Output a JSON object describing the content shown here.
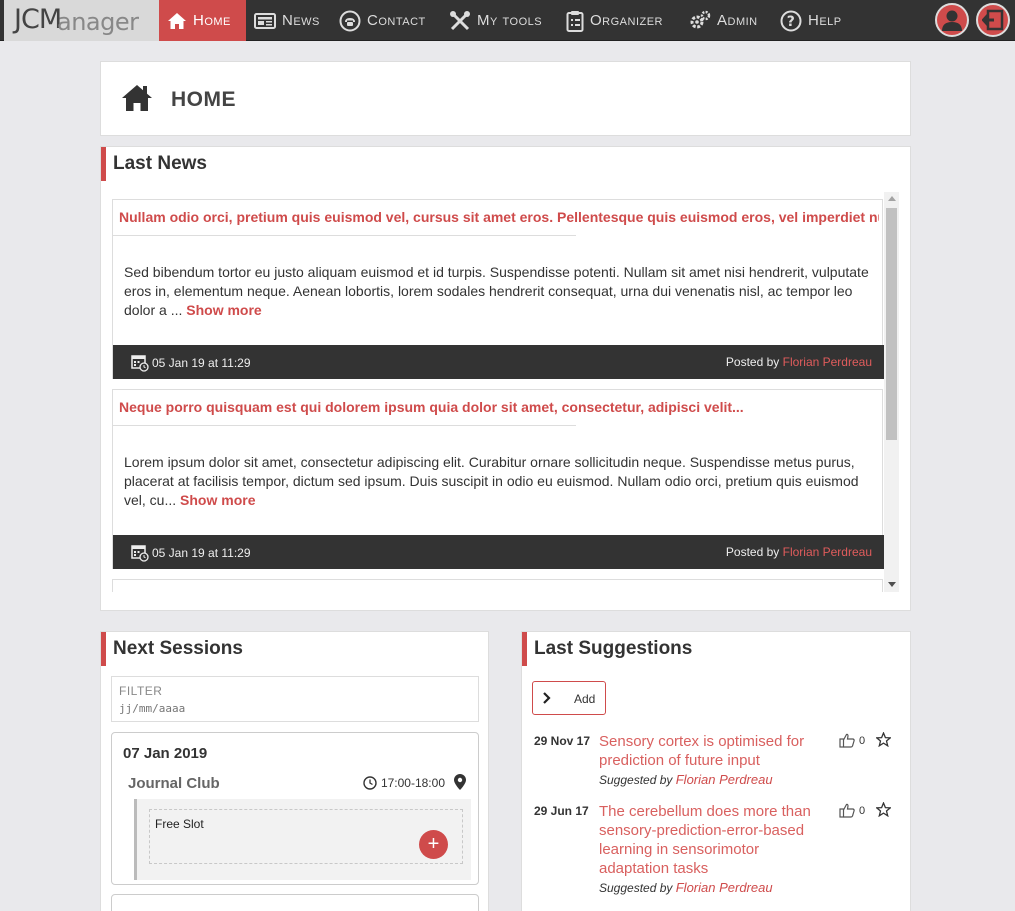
{
  "app": {
    "logo_main": "JCM",
    "logo_rest": "anager"
  },
  "nav": {
    "home": "Home",
    "news": "News",
    "contact": "Contact",
    "my_tools": "My tools",
    "organizer": "Organizer",
    "admin": "Admin",
    "help": "Help"
  },
  "page": {
    "title": "HOME"
  },
  "last_news": {
    "title": "Last News",
    "show_more": "Show more",
    "posted_by": "Posted by",
    "items": [
      {
        "title": "Nullam odio orci, pretium quis euismod vel, cursus sit amet eros. Pellentesque quis euismod eros, vel imperdiet nun",
        "body": "Sed bibendum tortor eu justo aliquam euismod et id turpis. Suspendisse potenti. Nullam sit amet nisi hendrerit, vulputate eros in, elementum neque. Aenean lobortis, lorem sodales hendrerit consequat, urna dui venenatis nisl, ac tempor leo dolor a ...",
        "date": "05 Jan 19 at 11:29",
        "author": "Florian Perdreau"
      },
      {
        "title": "Neque porro quisquam est qui dolorem ipsum quia dolor sit amet, consectetur, adipisci velit...",
        "body": "Lorem ipsum dolor sit amet, consectetur adipiscing elit. Curabitur ornare sollicitudin neque. Suspendisse metus purus, placerat at facilisis tempor, dictum sed ipsum. Duis suscipit in odio eu euismod. Nullam odio orci, pretium quis euismod vel, cu...",
        "date": "05 Jan 19 at 11:29",
        "author": "Florian Perdreau"
      }
    ]
  },
  "next_sessions": {
    "title": "Next Sessions",
    "filter_label": "FILTER",
    "filter_placeholder": "jj/mm/aaaa",
    "session": {
      "date": "07 Jan 2019",
      "type": "Journal Club",
      "time": "17:00-18:00",
      "slot_label": "Free Slot",
      "add_symbol": "+"
    }
  },
  "last_suggestions": {
    "title": "Last Suggestions",
    "add_label": "Add",
    "suggested_by": "Suggested by",
    "items": [
      {
        "date": "29 Nov 17",
        "title": "Sensory cortex is optimised for prediction of future input",
        "author": "Florian Perdreau",
        "votes": "0"
      },
      {
        "date": "29 Jun 17",
        "title": "The cerebellum does more than sensory-prediction-error-based learning in sensorimotor adaptation tasks",
        "author": "Florian Perdreau",
        "votes": "0"
      }
    ]
  },
  "colors": {
    "accent": "#cf4b4b",
    "navbar": "#333333",
    "background": "#e9e9ec"
  }
}
